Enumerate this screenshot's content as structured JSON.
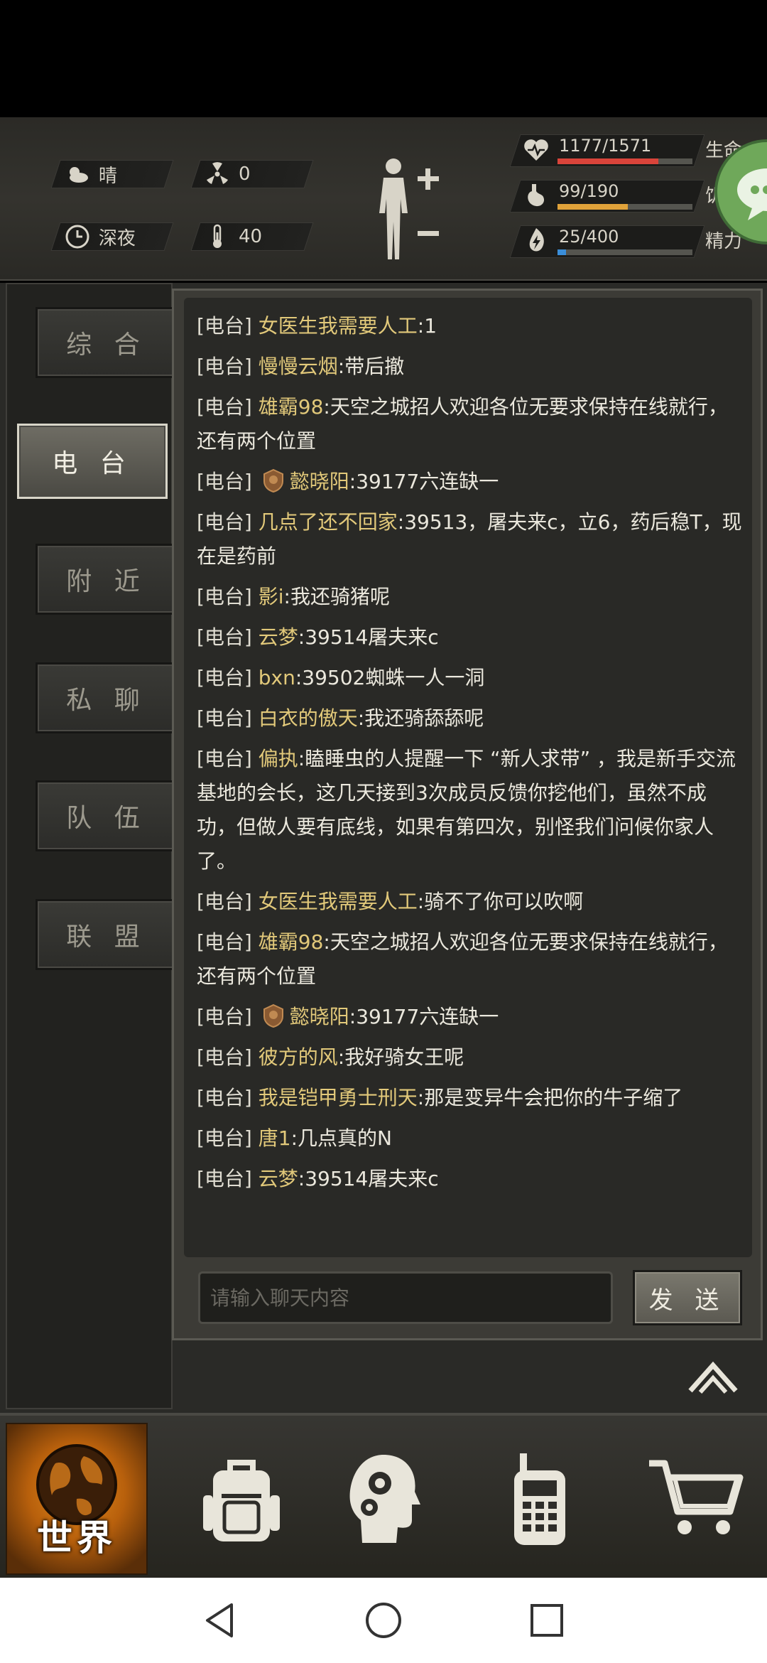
{
  "status": {
    "weather": "晴",
    "radiation": "0",
    "time_of_day": "深夜",
    "temperature": "40"
  },
  "bars": [
    {
      "label": "生命",
      "value": "1177/1571",
      "fraction": 0.749,
      "color": "#d9443a",
      "icon": "heart-icon"
    },
    {
      "label": "饥饿",
      "value": "99/190",
      "fraction": 0.521,
      "color": "#e0a23a",
      "icon": "stomach-icon"
    },
    {
      "label": "精力",
      "value": "25/400",
      "fraction": 0.0625,
      "color": "#3a8ed9",
      "icon": "energy-icon"
    }
  ],
  "tabs": [
    "综 合",
    "电 台",
    "附 近",
    "私 聊",
    "队 伍",
    "联 盟"
  ],
  "active_tab_index": 1,
  "chat": {
    "messages": [
      {
        "tag": "[电台]",
        "nick": "女医生我需要人工",
        "text": ":1",
        "badge": false
      },
      {
        "tag": "[电台]",
        "nick": "慢慢云烟",
        "text": ":带后撤",
        "badge": false
      },
      {
        "tag": "[电台]",
        "nick": "雄霸98",
        "text": ":天空之城招人欢迎各位无要求保持在线就行，还有两个位置",
        "badge": false
      },
      {
        "tag": "[电台]",
        "nick": "懿晓阳",
        "text": ":39177六连缺一",
        "badge": true
      },
      {
        "tag": "[电台]",
        "nick": "几点了还不回家",
        "text": ":39513，屠夫来c，立6，药后稳T，现在是药前",
        "badge": false
      },
      {
        "tag": "[电台]",
        "nick": "影i",
        "text": ":我还骑猪呢",
        "badge": false
      },
      {
        "tag": "[电台]",
        "nick": "云梦",
        "text": ":39514屠夫来c",
        "badge": false
      },
      {
        "tag": "[电台]",
        "nick": "bxn",
        "text": ":39502蜘蛛一人一洞",
        "badge": false
      },
      {
        "tag": "[电台]",
        "nick": "白衣的傲天",
        "text": ":我还骑舔舔呢",
        "badge": false
      },
      {
        "tag": "[电台]",
        "nick": "偏执",
        "text": ":瞌睡虫的人提醒一下 “新人求带” ，我是新手交流基地的会长，这几天接到3次成员反馈你挖他们，虽然不成功，但做人要有底线，如果有第四次，别怪我们问候你家人了。",
        "badge": false
      },
      {
        "tag": "[电台]",
        "nick": "女医生我需要人工",
        "text": ":骑不了你可以吹啊",
        "badge": false
      },
      {
        "tag": "[电台]",
        "nick": "雄霸98",
        "text": ":天空之城招人欢迎各位无要求保持在线就行，还有两个位置",
        "badge": false
      },
      {
        "tag": "[电台]",
        "nick": "懿晓阳",
        "text": ":39177六连缺一",
        "badge": true
      },
      {
        "tag": "[电台]",
        "nick": "彼方的风",
        "text": ":我好骑女王呢",
        "badge": false
      },
      {
        "tag": "[电台]",
        "nick": "我是铠甲勇士刑天",
        "text": ":那是变异牛会把你的牛子缩了",
        "badge": false
      },
      {
        "tag": "[电台]",
        "nick": "唐1",
        "text": ":几点真的N",
        "badge": false
      },
      {
        "tag": "[电台]",
        "nick": "云梦",
        "text": ":39514屠夫来c",
        "badge": false
      }
    ],
    "input_placeholder": "请输入聊天内容",
    "send_label": "发 送"
  },
  "nav": {
    "world_label": "世界",
    "items": [
      "globe-icon",
      "backpack-icon",
      "skills-head-icon",
      "radio-icon",
      "cart-icon"
    ]
  }
}
